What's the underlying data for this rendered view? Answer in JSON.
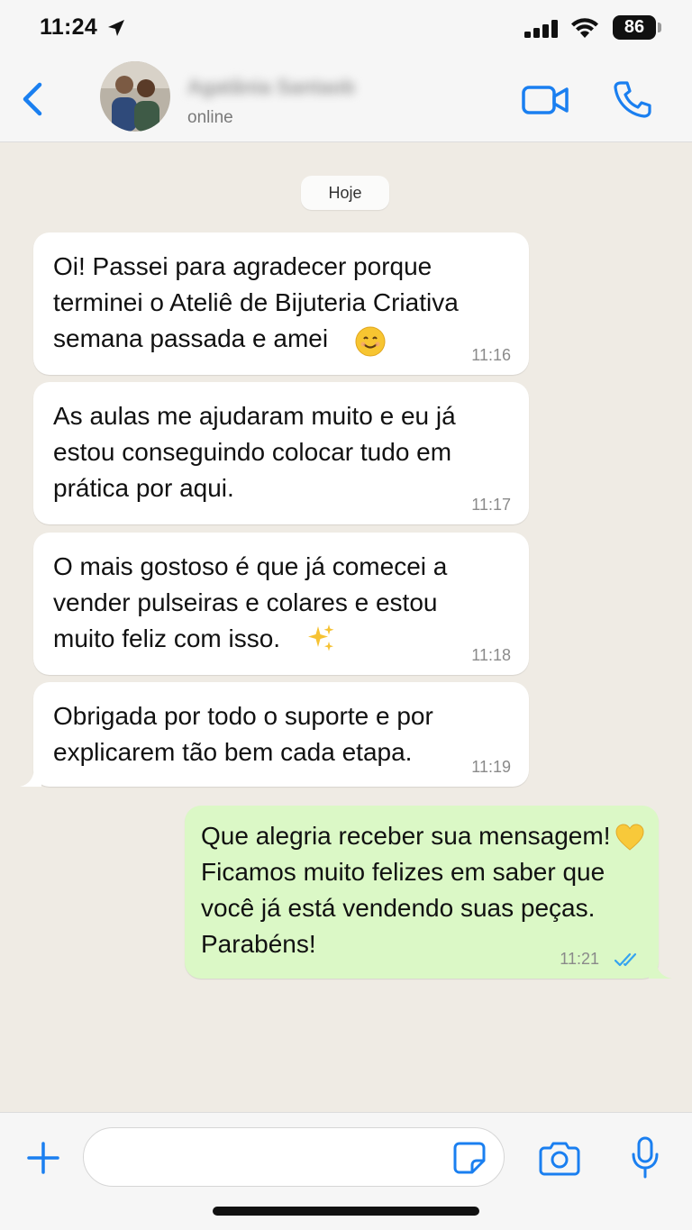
{
  "status_bar": {
    "time": "11:24",
    "battery": "86"
  },
  "header": {
    "contact_name": "Agatânia Santaob",
    "contact_status": "online",
    "icons": [
      "back-chevron-icon",
      "avatar-photo",
      "video-call-icon",
      "phone-icon"
    ]
  },
  "colors": {
    "accent": "#1a7ff0",
    "incoming_bubble": "#ffffff",
    "outgoing_bubble": "#dbf8c6",
    "chat_background": "#efebe4",
    "read_ticks": "#34a3f0"
  },
  "chat": {
    "date_chip": "Hoje",
    "messages": [
      {
        "direction": "in",
        "text": "Oi! Passei para agradecer porque\nterminei o Ateliê de Bijuteria Criativa\nsemana passada e amei",
        "emoji": "smiling-face-emoji",
        "time": "11:16"
      },
      {
        "direction": "in",
        "text": "As aulas me ajudaram muito e eu já\nestou conseguindo colocar tudo em\nprática por aqui.",
        "time": "11:17"
      },
      {
        "direction": "in",
        "text": "O mais gostoso é que já comecei a\nvender pulseiras e colares e estou\nmuito feliz com isso.",
        "emoji": "sparkles-emoji",
        "time": "11:18"
      },
      {
        "direction": "in",
        "text": "Obrigada por todo o suporte e por\nexplicarem tão bem cada etapa.",
        "time": "11:19"
      },
      {
        "direction": "out",
        "text": "Que alegria receber sua mensagem!\nFicamos muito felizes em saber que\nvocê já está vendendo suas peças.\nParabéns!",
        "emoji": "yellow-heart-emoji",
        "time": "11:21",
        "status": "read"
      }
    ]
  },
  "input_bar": {
    "value": "",
    "icons": [
      "plus-icon",
      "sticker-icon",
      "camera-icon",
      "microphone-icon"
    ]
  }
}
